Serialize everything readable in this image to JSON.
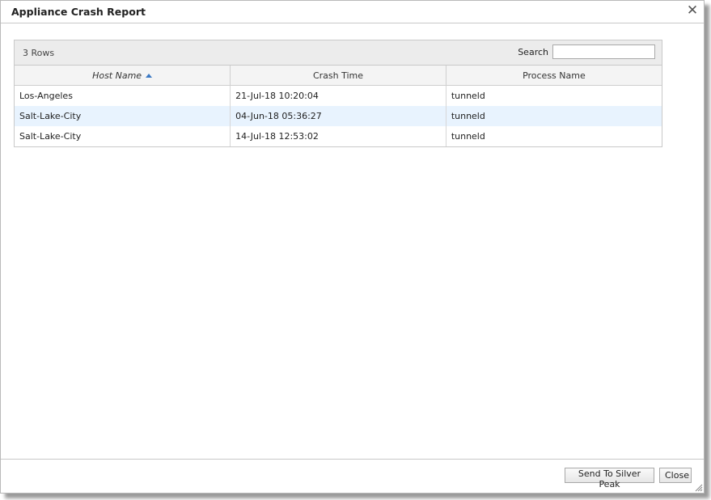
{
  "dialog": {
    "title": "Appliance Crash Report",
    "close_icon": "close-icon"
  },
  "grid": {
    "row_count_label": "3 Rows",
    "search": {
      "label": "Search",
      "value": "",
      "placeholder": ""
    },
    "columns": [
      {
        "label": "Host Name",
        "sorted": "ascending"
      },
      {
        "label": "Crash Time"
      },
      {
        "label": "Process Name"
      }
    ],
    "rows": [
      {
        "host": "Los-Angeles",
        "time": "21-Jul-18 10:20:04",
        "process": "tunneld"
      },
      {
        "host": "Salt-Lake-City",
        "time": "04-Jun-18 05:36:27",
        "process": "tunneld"
      },
      {
        "host": "Salt-Lake-City",
        "time": "14-Jul-18 12:53:02",
        "process": "tunneld"
      }
    ]
  },
  "footer": {
    "send_label": "Send To Silver Peak",
    "close_label": "Close"
  },
  "colors": {
    "alt_row": "#e8f3fe",
    "sort_arrow": "#3a78c3",
    "toolbar_bg": "#ececec"
  }
}
